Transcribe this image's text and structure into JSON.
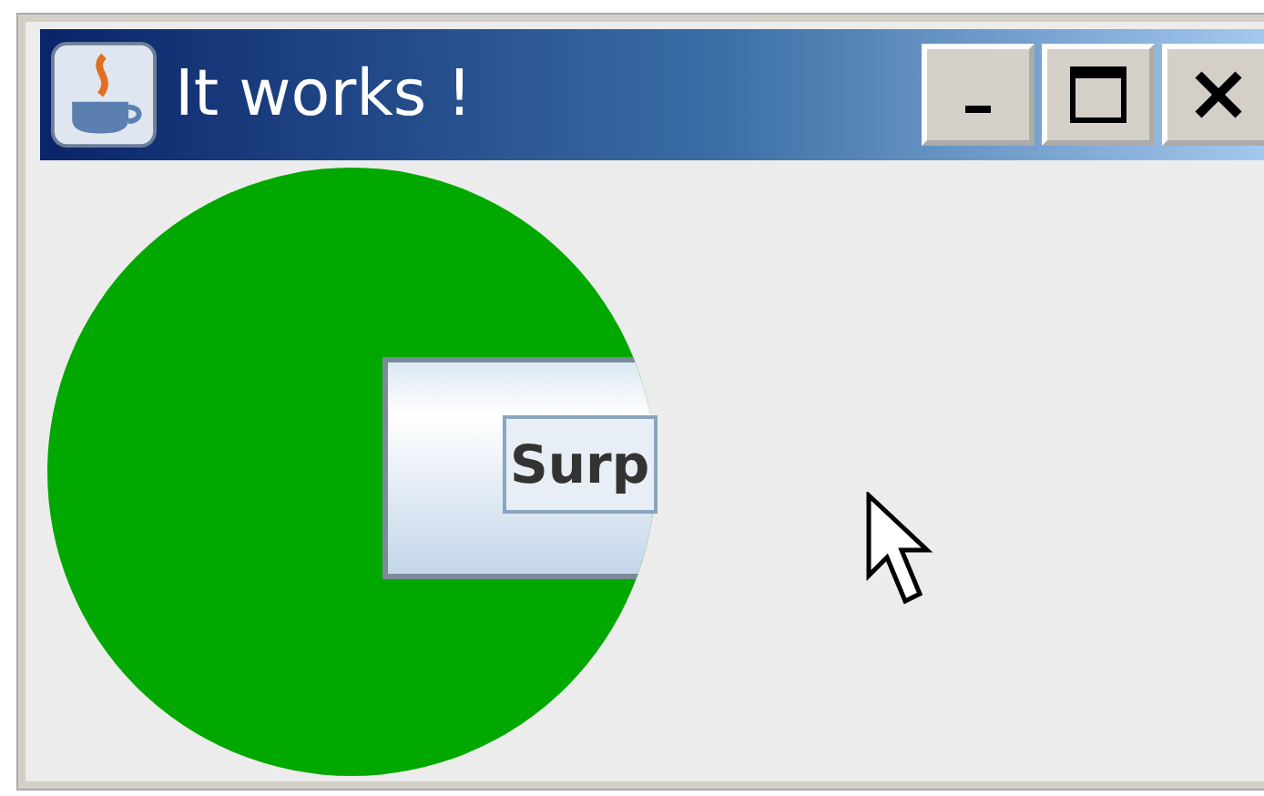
{
  "window": {
    "title": "It works !"
  },
  "canvas": {
    "button": {
      "label": "Surp"
    }
  }
}
